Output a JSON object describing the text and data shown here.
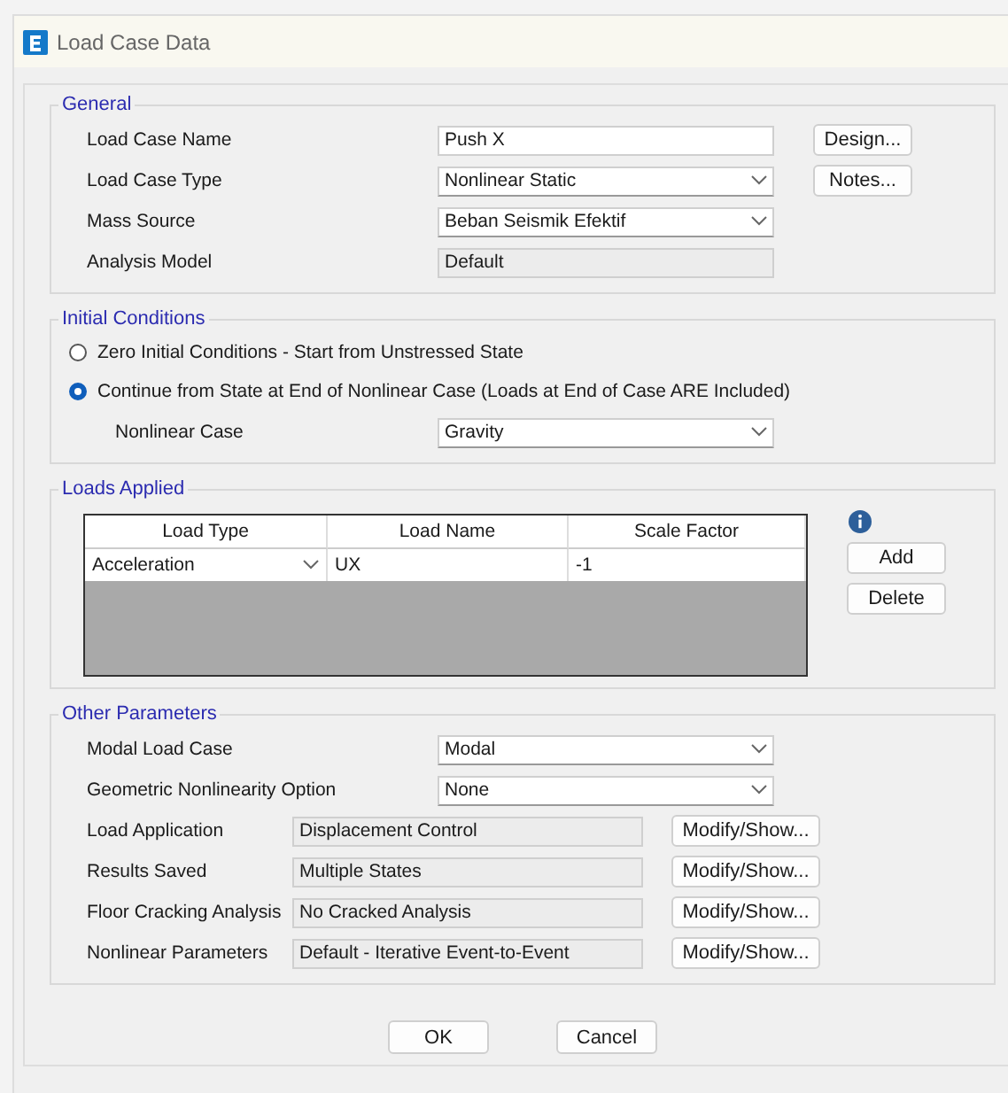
{
  "window": {
    "title": "Load Case Data"
  },
  "general": {
    "title": "General",
    "rows": [
      {
        "label": "Load Case Name",
        "kind": "text",
        "value": "Push X",
        "button": "Design..."
      },
      {
        "label": "Load Case Type",
        "kind": "combo",
        "value": "Nonlinear Static",
        "button": "Notes..."
      },
      {
        "label": "Mass Source",
        "kind": "combo",
        "value": "Beban Seismik Efektif"
      },
      {
        "label": "Analysis Model",
        "kind": "readonly",
        "value": "Default"
      }
    ]
  },
  "initial_conditions": {
    "title": "Initial Conditions",
    "options": [
      {
        "label": "Zero Initial Conditions - Start from Unstressed State",
        "selected": false
      },
      {
        "label": "Continue from State at End of Nonlinear Case  (Loads at End of Case ARE Included)",
        "selected": true
      }
    ],
    "nonlinear_case": {
      "label": "Nonlinear Case",
      "value": "Gravity"
    }
  },
  "loads_applied": {
    "title": "Loads Applied",
    "columns": [
      "Load Type",
      "Load Name",
      "Scale Factor"
    ],
    "rows": [
      [
        "Acceleration",
        "UX",
        "-1"
      ]
    ],
    "buttons": [
      "Add",
      "Delete"
    ]
  },
  "other_parameters": {
    "title": "Other Parameters",
    "rows": [
      {
        "label": "Modal Load Case",
        "kind": "combo",
        "value": "Modal"
      },
      {
        "label": "Geometric Nonlinearity Option",
        "kind": "combo",
        "value": "None"
      },
      {
        "label": "Load Application",
        "kind": "readonly",
        "value": "Displacement Control",
        "button": "Modify/Show..."
      },
      {
        "label": "Results Saved",
        "kind": "readonly",
        "value": "Multiple States",
        "button": "Modify/Show..."
      },
      {
        "label": "Floor Cracking Analysis",
        "kind": "readonly",
        "value": "No Cracked Analysis",
        "button": "Modify/Show..."
      },
      {
        "label": "Nonlinear Parameters",
        "kind": "readonly",
        "value": "Default - Iterative Event-to-Event",
        "button": "Modify/Show..."
      }
    ]
  },
  "buttons": [
    "OK",
    "Cancel"
  ]
}
